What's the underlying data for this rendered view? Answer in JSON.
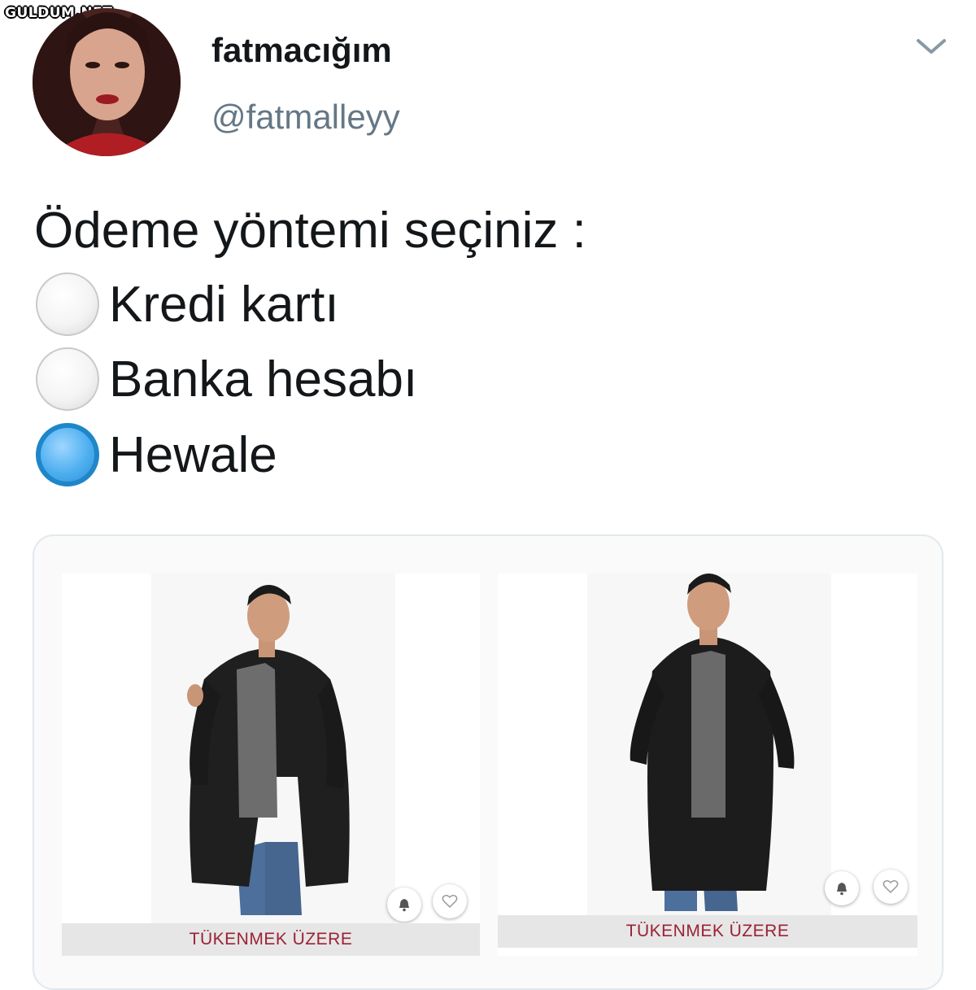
{
  "watermark": "GULDUM.NET",
  "profile": {
    "display_name": "fatmacığım",
    "handle": "@fatmalleyy"
  },
  "tweet": {
    "prompt": "Ödeme yöntemi seçiniz :",
    "options": [
      {
        "label": "Kredi kartı",
        "selected": false
      },
      {
        "label": "Banka hesabı",
        "selected": false
      },
      {
        "label": "Hewale",
        "selected": true
      }
    ]
  },
  "products": [
    {
      "label": "TÜKENMEK ÜZERE"
    },
    {
      "label": "TÜKENMEK ÜZERE"
    }
  ],
  "colors": {
    "selected_radio": "#2c8fd6",
    "handle": "#657786",
    "stock_label": "#9b2235"
  },
  "icons": [
    "chevron-down-icon",
    "bell-icon",
    "heart-icon"
  ]
}
